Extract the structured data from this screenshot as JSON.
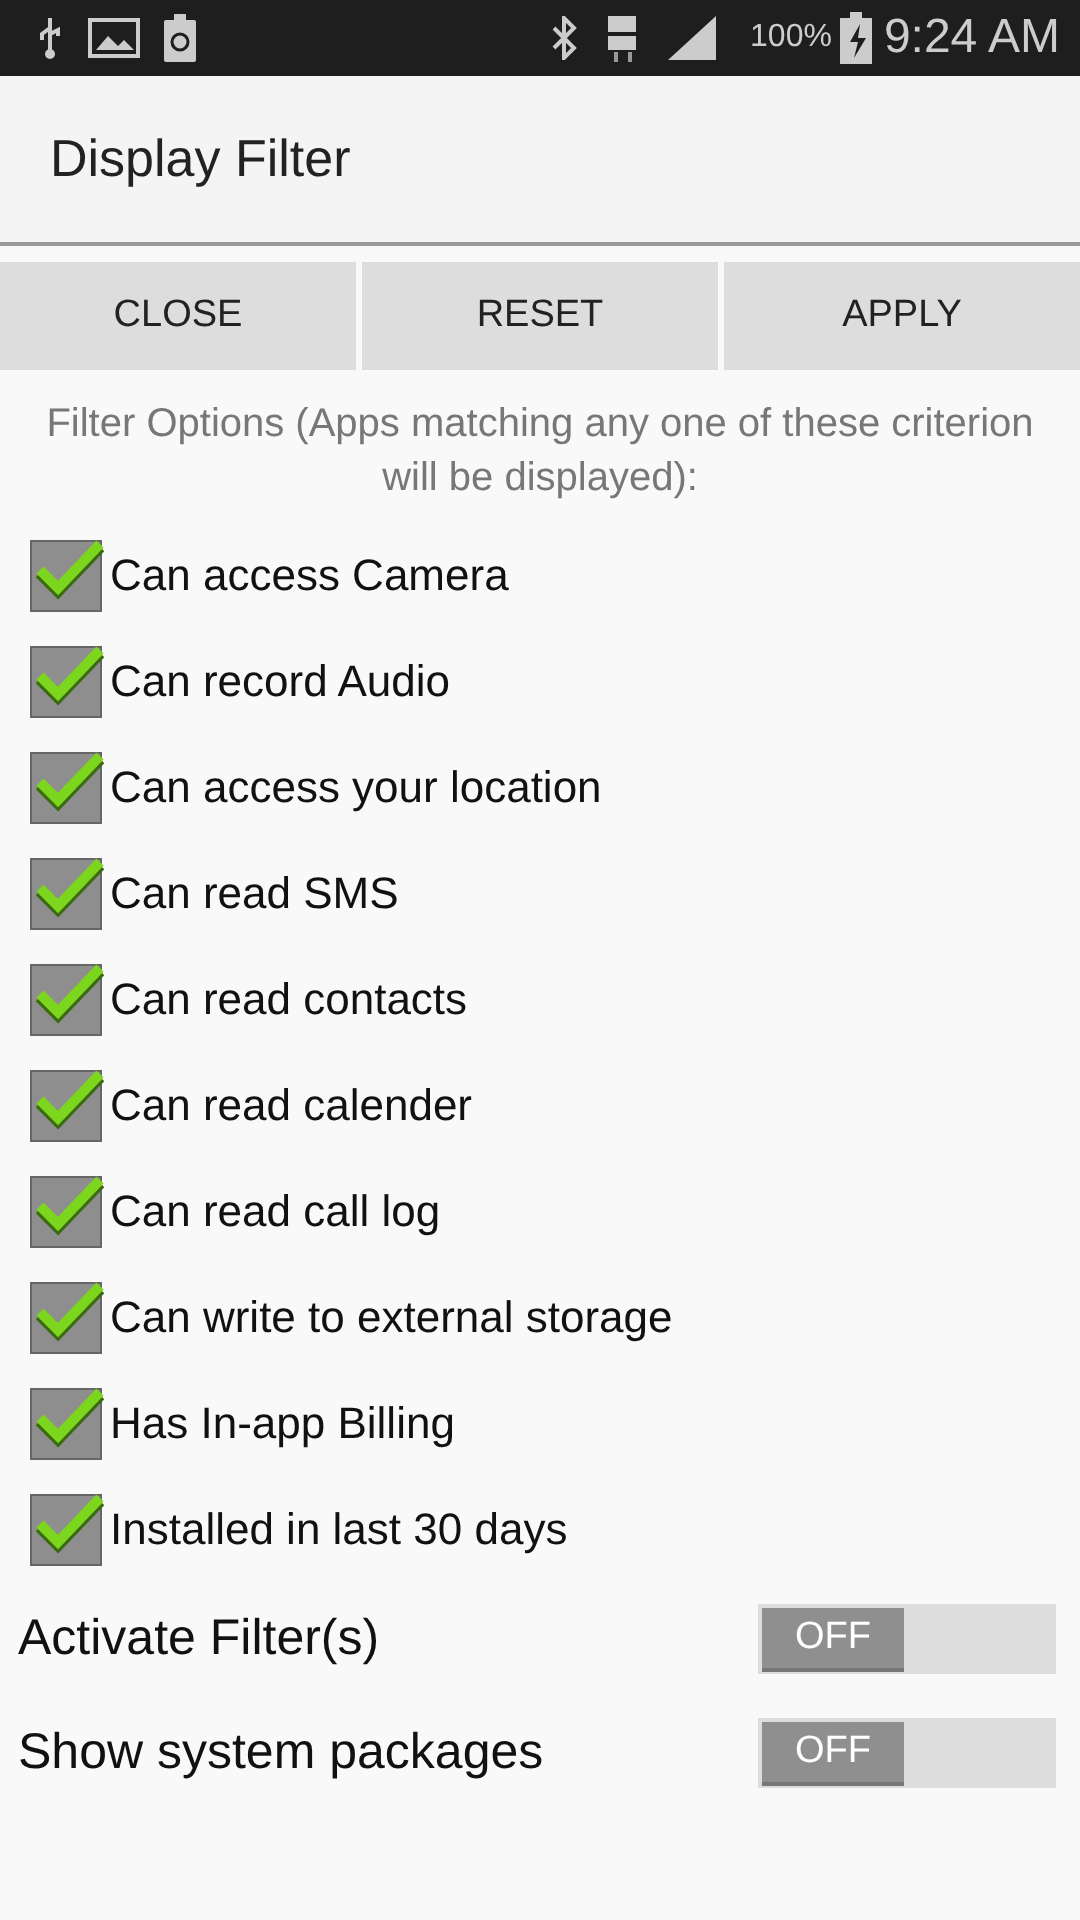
{
  "status_bar": {
    "battery": "100%",
    "time": "9:24 AM"
  },
  "title": "Display Filter",
  "buttons": [
    "CLOSE",
    "RESET",
    "APPLY"
  ],
  "hint": "Filter Options (Apps matching any one of these criterion will be displayed):",
  "filters": [
    {
      "label": "Can access Camera",
      "checked": true
    },
    {
      "label": "Can record Audio",
      "checked": true
    },
    {
      "label": "Can access your location",
      "checked": true
    },
    {
      "label": "Can read SMS",
      "checked": true
    },
    {
      "label": "Can read contacts",
      "checked": true
    },
    {
      "label": "Can read calender",
      "checked": true
    },
    {
      "label": "Can read call log",
      "checked": true
    },
    {
      "label": "Can write to external storage",
      "checked": true
    },
    {
      "label": "Has In-app Billing",
      "checked": true
    },
    {
      "label": "Installed in last 30 days",
      "checked": true
    }
  ],
  "switches": [
    {
      "label": "Activate Filter(s)",
      "on": false,
      "state_text": "OFF"
    },
    {
      "label": "Show system packages",
      "on": false,
      "state_text": "OFF"
    }
  ]
}
